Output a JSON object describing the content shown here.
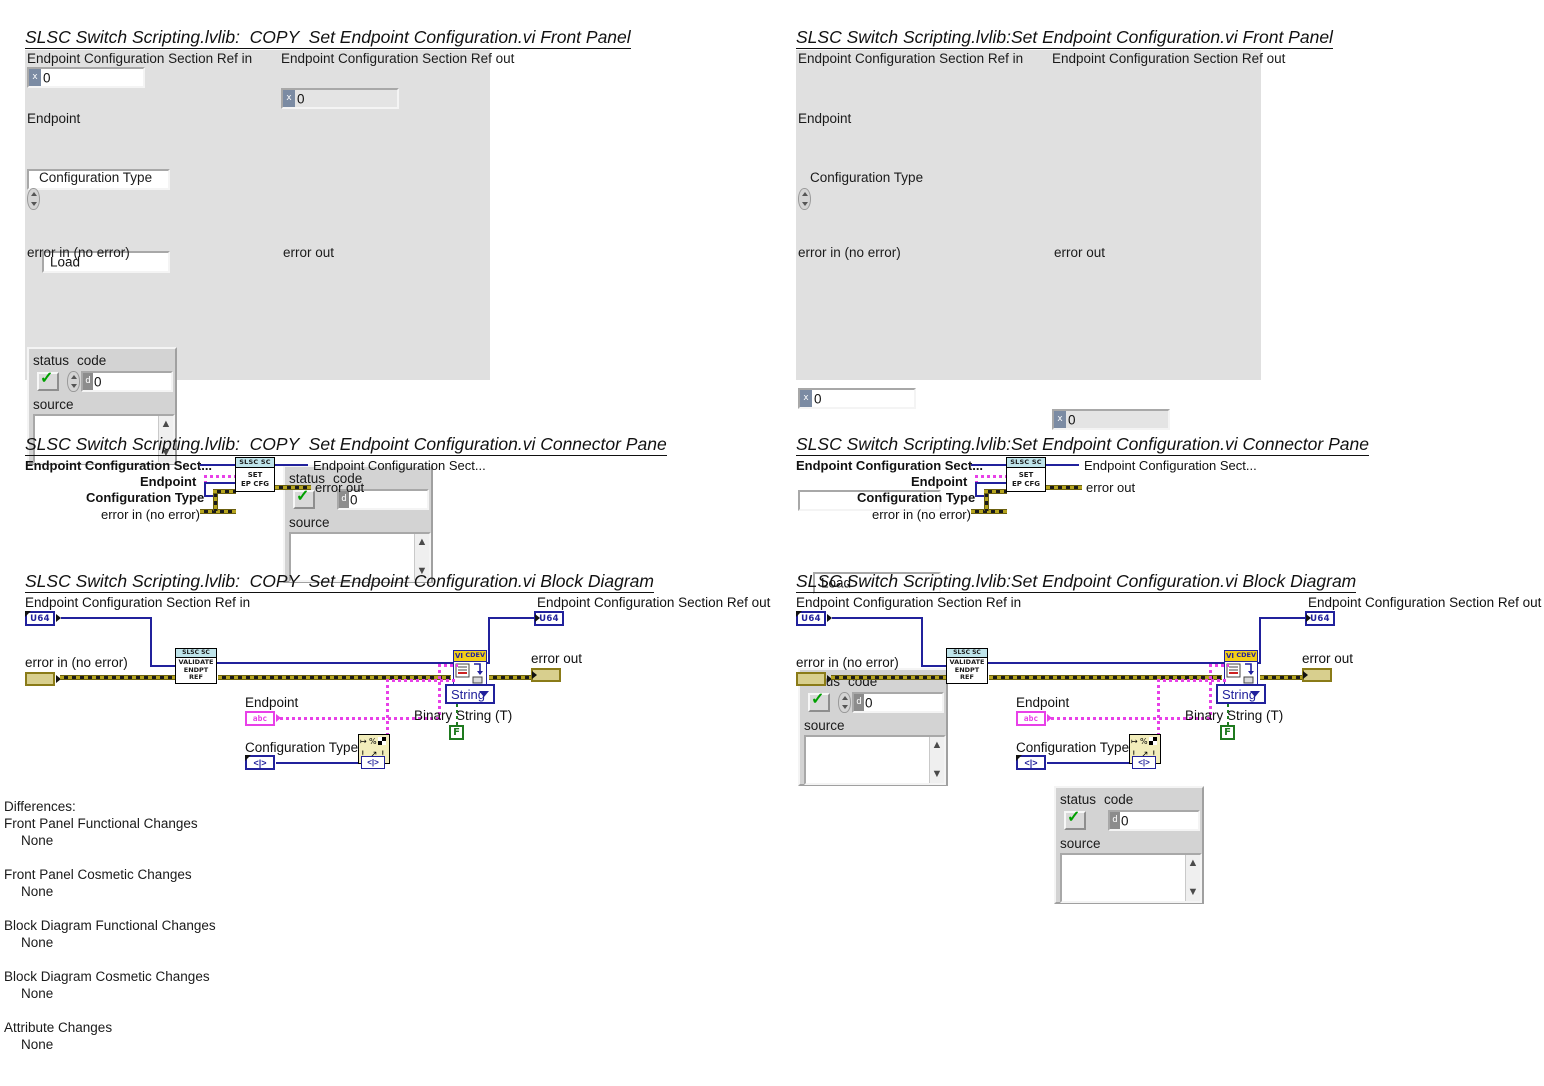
{
  "sections": {
    "left_front_panel_title": "SLSC Switch Scripting.lvlib:  COPY  Set Endpoint Configuration.vi Front Panel",
    "right_front_panel_title": "SLSC Switch Scripting.lvlib:Set Endpoint Configuration.vi Front Panel",
    "left_connector_title": "SLSC Switch Scripting.lvlib:  COPY  Set Endpoint Configuration.vi Connector Pane",
    "right_connector_title": "SLSC Switch Scripting.lvlib:Set Endpoint Configuration.vi Connector Pane",
    "left_block_title": "SLSC Switch Scripting.lvlib:  COPY  Set Endpoint Configuration.vi Block Diagram",
    "right_block_title": "SLSC Switch Scripting.lvlib:Set Endpoint Configuration.vi Block Diagram"
  },
  "front_panel": {
    "ref_in_label": "Endpoint Configuration Section Ref in",
    "ref_in_value": "0",
    "ref_in_radix": "x",
    "ref_out_label": "Endpoint Configuration Section Ref out",
    "ref_out_value": "0",
    "ref_out_radix": "x",
    "endpoint_label": "Endpoint",
    "endpoint_value": "",
    "config_type_label": "Configuration Type",
    "config_type_value": "Load",
    "error_in_label": "error in (no error)",
    "error_out_label": "error out",
    "status_label": "status",
    "code_label": "code",
    "source_label": "source",
    "code_value": "0",
    "code_radix": "d",
    "source_value": ""
  },
  "connector_pane": {
    "terminals_left": [
      "Endpoint Configuration Sect...",
      "Endpoint",
      "Configuration Type",
      "error in (no error)"
    ],
    "terminals_right": [
      "Endpoint Configuration Sect...",
      "error out"
    ],
    "icon_header": "SLSC SC",
    "icon_line1": "SET",
    "icon_line2": "EP CFG"
  },
  "block_diagram": {
    "ref_in_label": "Endpoint Configuration Section Ref in",
    "ref_in_type": "U64",
    "ref_out_label": "Endpoint Configuration Section Ref out",
    "ref_out_type": "U64",
    "error_in_label": "error in (no error)",
    "error_out_label": "error out",
    "endpoint_label": "Endpoint",
    "endpoint_type": "abc",
    "config_type_label": "Configuration Type",
    "config_type_type": "<|>",
    "validate_header": "SLSC SC",
    "validate_line1": "VALIDATE",
    "validate_line2": "ENDPT",
    "validate_line3": "REF",
    "property_node_tag": "CDEV",
    "property_node_vi": "VI",
    "string_ring_value": "String",
    "binary_string_label": "Binary String (T)",
    "binary_string_value": "F"
  },
  "differences": {
    "heading": "Differences:",
    "items": [
      {
        "category": "Front Panel Functional Changes",
        "value": "None"
      },
      {
        "category": "Front Panel Cosmetic Changes",
        "value": "None"
      },
      {
        "category": "Block Diagram Functional Changes",
        "value": "None"
      },
      {
        "category": "Block Diagram Cosmetic Changes",
        "value": "None"
      },
      {
        "category": "Attribute Changes",
        "value": "None"
      }
    ]
  },
  "colors": {
    "panel_bg": "#e0e0e0",
    "error_wire": "#b5a41e",
    "ref_wire": "#21219c",
    "string_wire": "#e840e8",
    "boolean_wire": "#1f7a1f"
  }
}
